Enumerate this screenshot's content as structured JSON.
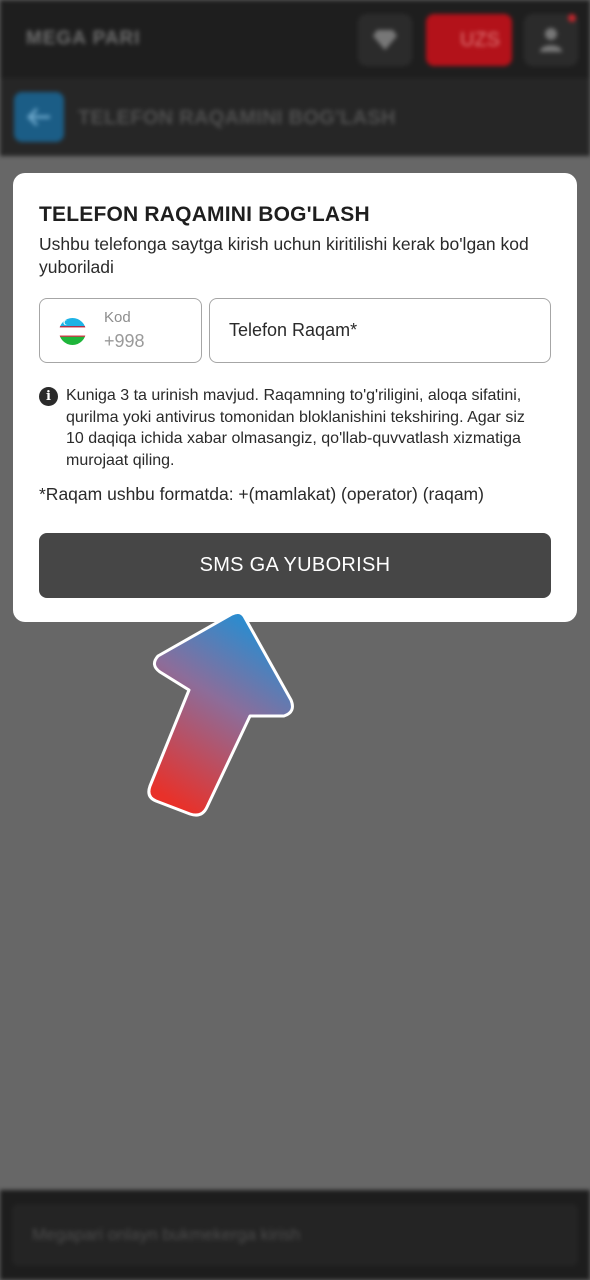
{
  "app": {
    "logo_text": "MEGA PARI",
    "currency_label": "UZS"
  },
  "subheader": {
    "title": "TELEFON RAQAMINI BOG'LASH"
  },
  "modal": {
    "title": "TELEFON RAQAMINI BOG'LASH",
    "description": "Ushbu telefonga saytga kirish uchun kiritilishi kerak bo'lgan kod yuboriladi",
    "code_field": {
      "label": "Kod",
      "value": "+998"
    },
    "phone_field": {
      "placeholder": "Telefon Raqam*"
    },
    "info_text": "Kuniga 3 ta urinish mavjud. Raqamning to'g'riligini, aloqa sifatini, qurilma yoki antivirus tomonidan bloklanishini tekshiring. Agar siz 10 daqiqa ichida xabar olmasangiz, qo'llab-quvvatlash xizmatiga murojaat qiling.",
    "format_note": "*Raqam ushbu formatda: +(mamlakat) (operator) (raqam)",
    "submit_label": "SMS GA YUBORISH"
  },
  "bottom_bar": {
    "placeholder": "Megapari onlayn bukmekerga kirish"
  },
  "icons": {
    "favorites": "diamond-icon",
    "account": "user-icon",
    "back": "arrow-left-icon",
    "info": "info-icon",
    "flag": "uzbekistan-flag-icon"
  },
  "colors": {
    "accent_red": "#b3121a",
    "back_button_blue": "#1b5d86",
    "submit_button": "#464646",
    "arrow_gradient_top": "#1e90d6",
    "arrow_gradient_bottom": "#e8312a"
  }
}
